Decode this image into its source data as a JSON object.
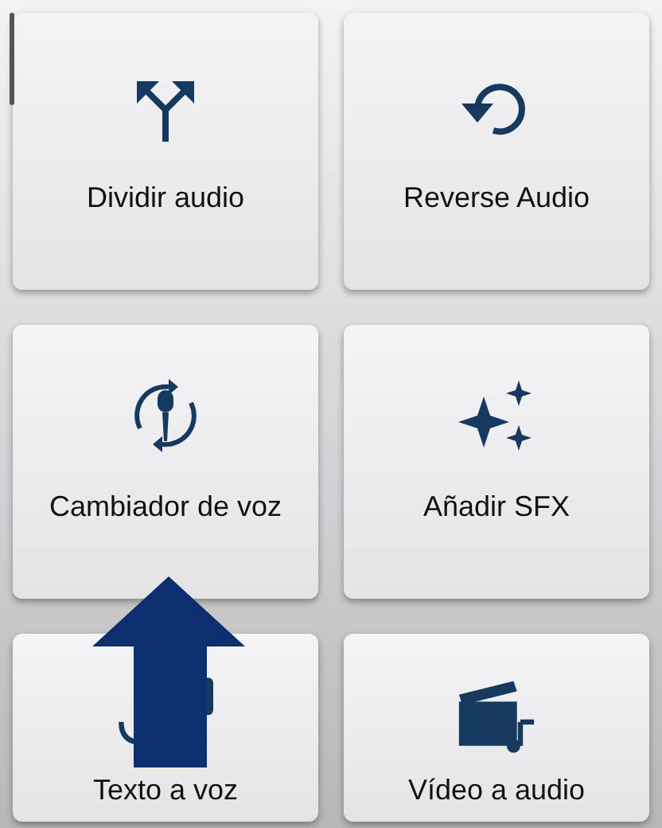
{
  "tools": [
    {
      "kind": "split",
      "label": "Dividir audio"
    },
    {
      "kind": "reverse",
      "label": "Reverse Audio"
    },
    {
      "kind": "voice",
      "label": "Cambiador de voz"
    },
    {
      "kind": "sfx",
      "label": "Añadir SFX"
    },
    {
      "kind": "tts",
      "label": "Texto a voz"
    },
    {
      "kind": "video",
      "label": "Vídeo a audio"
    }
  ],
  "overlay": {
    "kind": "up-arrow"
  }
}
